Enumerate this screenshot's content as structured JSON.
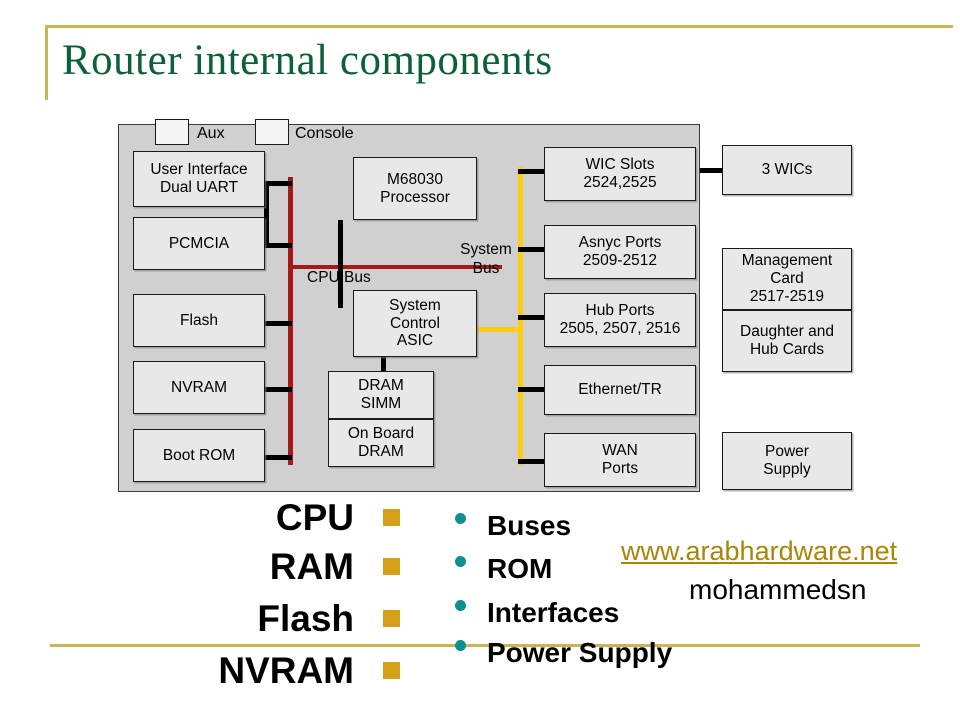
{
  "slide": {
    "title": "Router internal components",
    "title_color": "#0d6137",
    "rule_color": "#c9b458"
  },
  "diagram": {
    "panel_bg": "#d0d0d0",
    "top_ports": [
      {
        "id": "aux",
        "label": "Aux"
      },
      {
        "id": "console",
        "label": "Console"
      }
    ],
    "bus_labels": [
      {
        "id": "cpu-bus",
        "label": "CPU Bus",
        "color": "#a51919"
      },
      {
        "id": "system-bus",
        "label": "System\nBus",
        "line1": "System",
        "line2": "Bus",
        "color": "#ffcc11"
      }
    ],
    "left_column": [
      {
        "id": "user-interface-dual-uart",
        "line1": "User Interface",
        "line2": "Dual UART"
      },
      {
        "id": "pcmcia",
        "line1": "PCMCIA",
        "line2": ""
      },
      {
        "id": "flash",
        "line1": "Flash",
        "line2": ""
      },
      {
        "id": "nvram",
        "line1": "NVRAM",
        "line2": ""
      },
      {
        "id": "boot-rom",
        "line1": "Boot ROM",
        "line2": ""
      }
    ],
    "center_column": [
      {
        "id": "m68030-processor",
        "line1": "M68030",
        "line2": "Processor"
      },
      {
        "id": "system-control-asic",
        "line1": "System",
        "line2": "Control",
        "line3": "ASIC"
      },
      {
        "id": "dram-simm",
        "line1": "DRAM",
        "line2": "SIMM"
      },
      {
        "id": "on-board-dram",
        "line1": "On Board",
        "line2": "DRAM"
      }
    ],
    "interface_column": [
      {
        "id": "wic-slots",
        "line1": "WIC Slots",
        "line2": "2524,2525"
      },
      {
        "id": "async-ports",
        "line1": "Asnyc Ports",
        "line2": "2509-2512"
      },
      {
        "id": "hub-ports",
        "line1": "Hub Ports",
        "line2": "2505, 2507, 2516"
      },
      {
        "id": "ethernet-tr",
        "line1": "Ethernet/TR",
        "line2": ""
      },
      {
        "id": "wan-ports",
        "line1": "WAN",
        "line2": "Ports"
      }
    ],
    "external_column": [
      {
        "id": "three-wics",
        "line1": "3 WICs",
        "line2": "",
        "line3": ""
      },
      {
        "id": "management-card",
        "line1": "Management",
        "line2": "Card",
        "line3": "2517-2519"
      },
      {
        "id": "daughter-hub-cards",
        "line1": "Daughter and",
        "line2": "Hub Cards",
        "line3": ""
      },
      {
        "id": "power-supply",
        "line1": "Power",
        "line2": "Supply",
        "line3": ""
      }
    ]
  },
  "summary": {
    "left_items": [
      {
        "id": "cpu",
        "label": "CPU"
      },
      {
        "id": "ram",
        "label": "RAM"
      },
      {
        "id": "flash",
        "label": "Flash"
      },
      {
        "id": "nvram",
        "label": "NVRAM"
      }
    ],
    "left_bullet_color": "#d4a017",
    "right_items": [
      {
        "id": "buses",
        "label": "Buses"
      },
      {
        "id": "rom",
        "label": "ROM"
      },
      {
        "id": "interfaces",
        "label": "Interfaces"
      },
      {
        "id": "power-supply",
        "label": "Power Supply"
      }
    ],
    "right_bullet_color": "#0e8f91"
  },
  "credits": {
    "url": "www.arabhardware.net",
    "url_color": "#a8860b",
    "author": "mohammedsn"
  }
}
